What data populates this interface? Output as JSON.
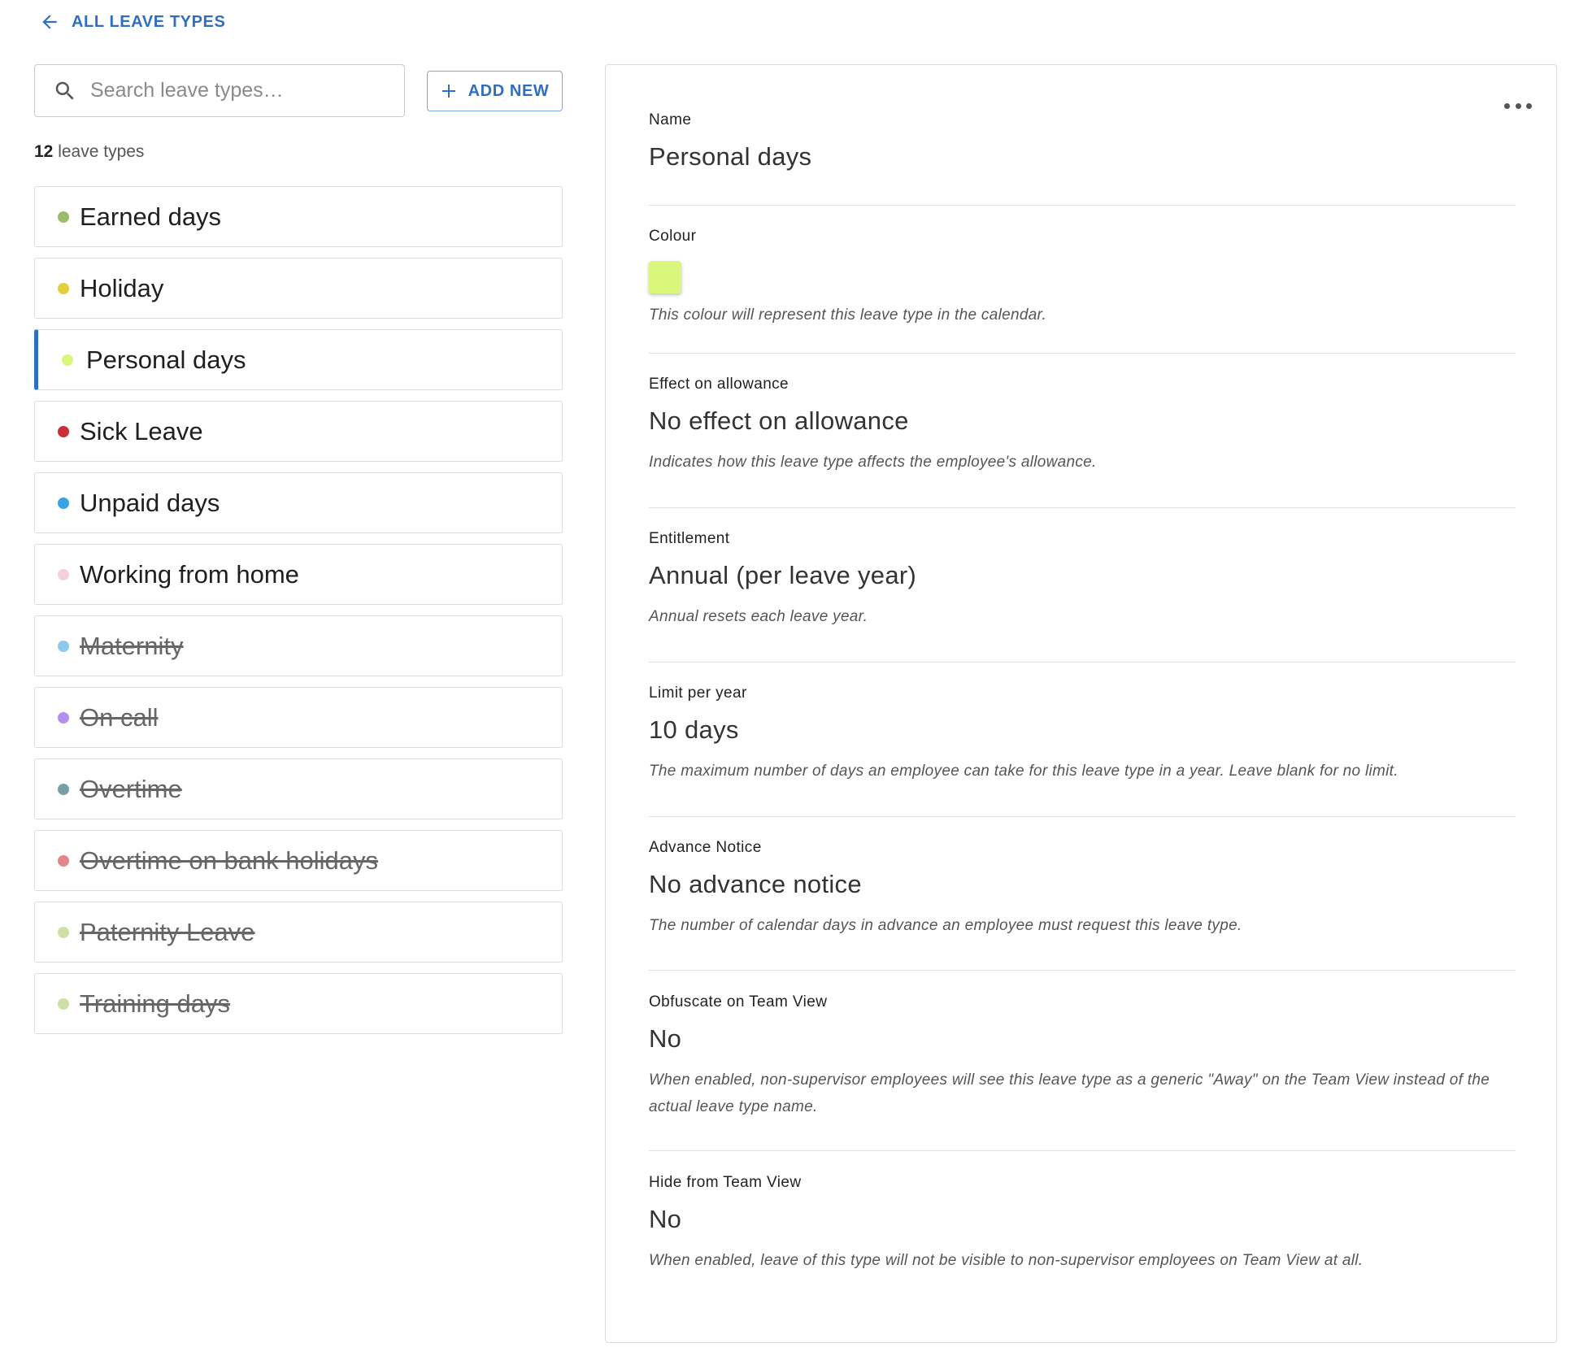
{
  "back_link": {
    "label": "ALL LEAVE TYPES"
  },
  "search": {
    "placeholder": "Search leave types…"
  },
  "add_new": {
    "label": "ADD NEW"
  },
  "count": {
    "number": "12",
    "suffix": "leave types"
  },
  "leave_types": [
    {
      "name": "Earned days",
      "color": "#9bbd6a",
      "archived": false,
      "selected": false
    },
    {
      "name": "Holiday",
      "color": "#e3cf3a",
      "archived": false,
      "selected": false
    },
    {
      "name": "Personal days",
      "color": "#d9f77a",
      "archived": false,
      "selected": true
    },
    {
      "name": "Sick Leave",
      "color": "#cc2f3a",
      "archived": false,
      "selected": false
    },
    {
      "name": "Unpaid days",
      "color": "#3aa3e3",
      "archived": false,
      "selected": false
    },
    {
      "name": "Working from home",
      "color": "#f3cfe0",
      "archived": false,
      "selected": false
    },
    {
      "name": "Maternity",
      "color": "#8ec9ef",
      "archived": true,
      "selected": false
    },
    {
      "name": "On call",
      "color": "#b38ff0",
      "archived": true,
      "selected": false
    },
    {
      "name": "Overtime",
      "color": "#7a9ea8",
      "archived": true,
      "selected": false
    },
    {
      "name": "Overtime on bank holidays",
      "color": "#e58589",
      "archived": true,
      "selected": false
    },
    {
      "name": "Paternity Leave",
      "color": "#cfe0a6",
      "archived": true,
      "selected": false
    },
    {
      "name": "Training days",
      "color": "#cfe0a6",
      "archived": true,
      "selected": false
    }
  ],
  "detail": {
    "menu_icon": "more-horizontal-icon",
    "name": {
      "label": "Name",
      "value": "Personal days"
    },
    "colour": {
      "label": "Colour",
      "swatch": "#d9f77a",
      "desc": "This colour will represent this leave type in the calendar."
    },
    "effect": {
      "label": "Effect on allowance",
      "value": "No effect on allowance",
      "desc": "Indicates how this leave type affects the employee's allowance."
    },
    "entitlement": {
      "label": "Entitlement",
      "value": "Annual (per leave year)",
      "desc": "Annual resets each leave year."
    },
    "limit": {
      "label": "Limit per year",
      "value": "10 days",
      "desc": "The maximum number of days an employee can take for this leave type in a year. Leave blank for no limit."
    },
    "advance": {
      "label": "Advance Notice",
      "value": "No advance notice",
      "desc": "The number of calendar days in advance an employee must request this leave type."
    },
    "obfuscate": {
      "label": "Obfuscate on Team View",
      "value": "No",
      "desc": "When enabled, non-supervisor employees will see this leave type as a generic \"Away\" on the Team View instead of the actual leave type name."
    },
    "hide": {
      "label": "Hide from Team View",
      "value": "No",
      "desc": "When enabled, leave of this type will not be visible to non-supervisor employees on Team View at all."
    }
  },
  "colors": {
    "accent": "#2f6fc2"
  }
}
